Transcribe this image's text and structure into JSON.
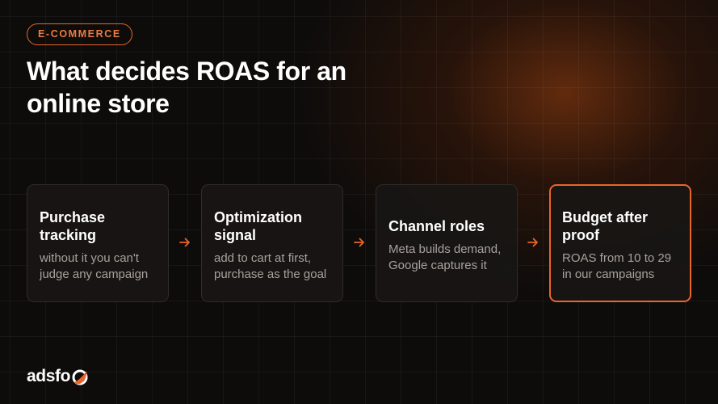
{
  "badge": "E-COMMERCE",
  "title": "What decides ROAS for an online store",
  "steps": [
    {
      "title": "Purchase tracking",
      "desc": "without it you can't judge any campaign"
    },
    {
      "title": "Optimization signal",
      "desc": "add to cart at first, purchase as the goal"
    },
    {
      "title": "Channel roles",
      "desc": "Meta builds demand, Google captures it"
    },
    {
      "title": "Budget after proof",
      "desc": "ROAS from 10 to 29 in our campaigns"
    }
  ],
  "brand": {
    "name": "adsfo",
    "mark_icon": "fox-tail-icon"
  },
  "colors": {
    "accent": "#e8652c",
    "background": "#0e0c0b",
    "card": "#181615",
    "muted_text": "#a8a19c"
  }
}
